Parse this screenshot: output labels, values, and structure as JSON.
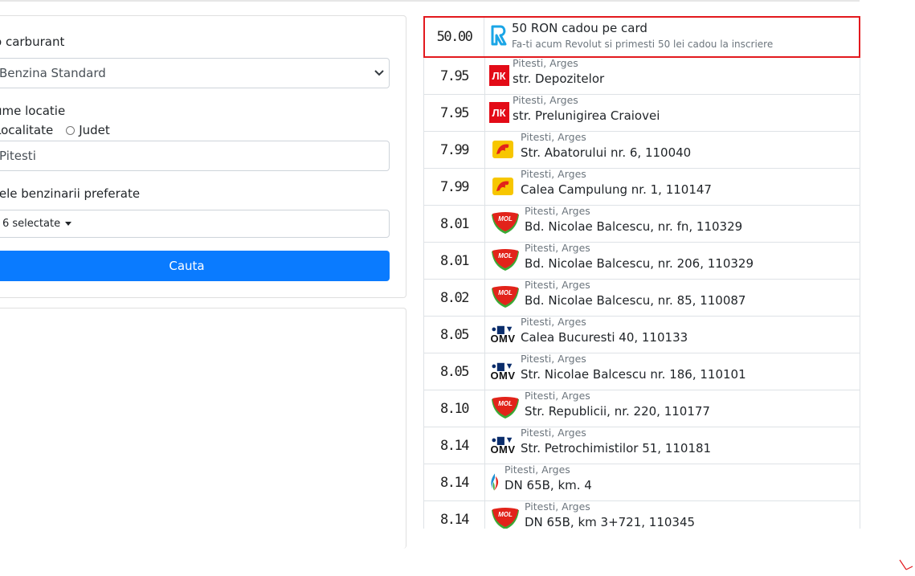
{
  "form": {
    "fuel_label": "o carburant",
    "fuel_value": "Benzina Standard",
    "location_label": "ume locatie",
    "radio_locality": "Localitate",
    "radio_county": "Judet",
    "location_value": "Pitesti",
    "brands_label": "tele benzinarii preferate",
    "brands_value": "6 selectate",
    "search_button": "Cauta"
  },
  "promo": {
    "price": "50.00",
    "title": "50 RON cadou pe card",
    "subtitle": "Fa-ti acum Revolut si primesti 50 lei cadou la inscriere",
    "logo": "revolut-logo",
    "border_color": "#e3191e"
  },
  "stations": [
    {
      "price": "7.95",
      "city": "Pitesti, Arges",
      "address": "str. Depozitelor",
      "brand": "lukoil"
    },
    {
      "price": "7.95",
      "city": "Pitesti, Arges",
      "address": "str. Prelunigirea Craiovei",
      "brand": "lukoil"
    },
    {
      "price": "7.99",
      "city": "Pitesti, Arges",
      "address": "Str. Abatorului nr. 6, 110040",
      "brand": "petrom"
    },
    {
      "price": "7.99",
      "city": "Pitesti, Arges",
      "address": "Calea Campulung nr. 1, 110147",
      "brand": "petrom"
    },
    {
      "price": "8.01",
      "city": "Pitesti, Arges",
      "address": "Bd. Nicolae Balcescu, nr. fn, 110329",
      "brand": "mol"
    },
    {
      "price": "8.01",
      "city": "Pitesti, Arges",
      "address": "Bd. Nicolae Balcescu, nr. 206, 110329",
      "brand": "mol"
    },
    {
      "price": "8.02",
      "city": "Pitesti, Arges",
      "address": "Bd. Nicolae Balcescu, nr. 85, 110087",
      "brand": "mol"
    },
    {
      "price": "8.05",
      "city": "Pitesti, Arges",
      "address": "Calea Bucuresti 40, 110133",
      "brand": "omv"
    },
    {
      "price": "8.05",
      "city": "Pitesti, Arges",
      "address": "Str. Nicolae Balcescu nr. 186, 110101",
      "brand": "omv"
    },
    {
      "price": "8.10",
      "city": "Pitesti, Arges",
      "address": "Str. Republicii, nr. 220, 110177",
      "brand": "mol"
    },
    {
      "price": "8.14",
      "city": "Pitesti, Arges",
      "address": "Str. Petrochimistilor 51, 110181",
      "brand": "omv"
    },
    {
      "price": "8.14",
      "city": "Pitesti, Arges",
      "address": "DN 65B, km. 4",
      "brand": "socar"
    },
    {
      "price": "8.14",
      "city": "Pitesti, Arges",
      "address": "DN 65B, km 3+721, 110345",
      "brand": "mol"
    }
  ],
  "colors": {
    "primary": "#0a7bff",
    "lukoil": "#e30b17",
    "mol": "#e2231a",
    "omv": "#0b2d6b"
  }
}
